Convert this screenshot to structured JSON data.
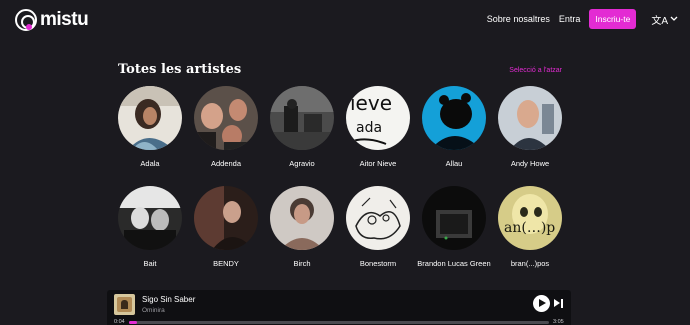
{
  "brand": {
    "name": "mistu",
    "accent": "#e32bd3"
  },
  "nav": {
    "about": "Sobre nosaltres",
    "login": "Entra",
    "signup": "Inscriu-te",
    "language_glyph": "文A"
  },
  "section": {
    "title": "Totes les artistes",
    "random_link": "Selecció a l'atzar"
  },
  "artists": [
    {
      "name": "Adala"
    },
    {
      "name": "Addenda"
    },
    {
      "name": "Agravio"
    },
    {
      "name": "Aitor Nieve"
    },
    {
      "name": "Allau"
    },
    {
      "name": "Andy Howe"
    },
    {
      "name": "Bait"
    },
    {
      "name": "BENDY"
    },
    {
      "name": "Birch"
    },
    {
      "name": "Bonestorm"
    },
    {
      "name": "Brandon Lucas Green"
    },
    {
      "name": "bran(...)pos"
    }
  ],
  "player": {
    "track_title": "Sigo Sin Saber",
    "track_artist": "Ominira",
    "current_time": "0:04",
    "total_time": "3:05",
    "progress": 0.02
  }
}
